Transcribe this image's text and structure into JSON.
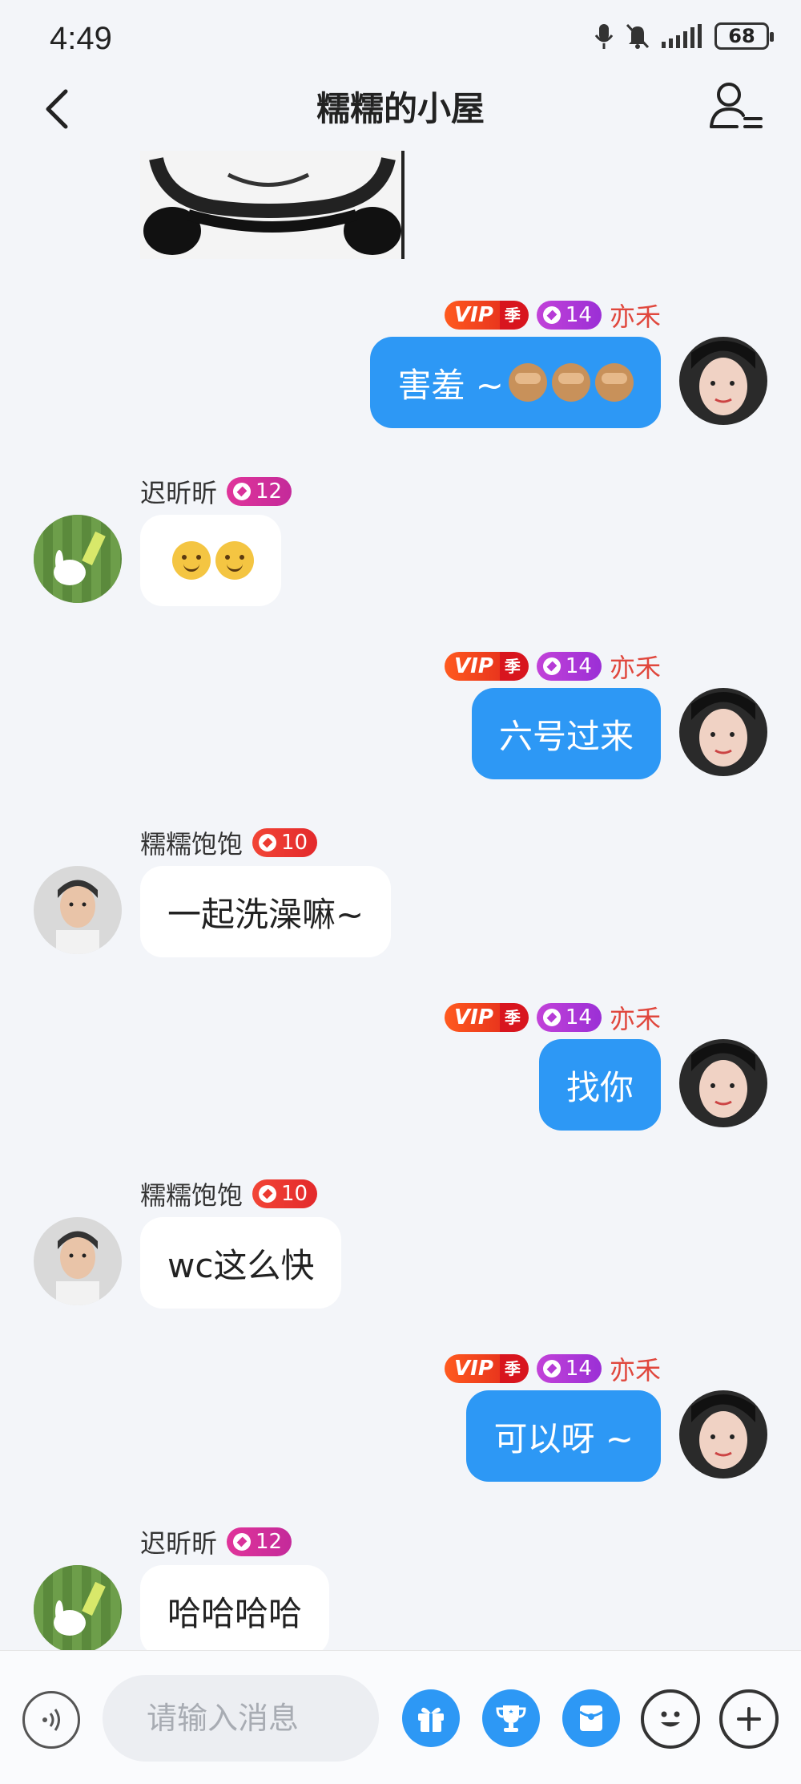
{
  "status_bar": {
    "time": "4:49",
    "battery": "68"
  },
  "header": {
    "title": "糯糯的小屋"
  },
  "messages": [
    {
      "dir": "out",
      "vip": "VIP",
      "vip_season": "季",
      "level": "14",
      "name": "亦禾",
      "text": "害羞 ~ ",
      "emojis": [
        "see-no-evil-monkey",
        "see-no-evil-monkey",
        "see-no-evil-monkey"
      ]
    },
    {
      "dir": "in",
      "name": "迟昕昕",
      "level": "12",
      "emojis": [
        "slightly-smiling-face",
        "slightly-smiling-face"
      ]
    },
    {
      "dir": "out",
      "vip": "VIP",
      "vip_season": "季",
      "level": "14",
      "name": "亦禾",
      "text": "六号过来"
    },
    {
      "dir": "in",
      "name": "糯糯饱饱",
      "level": "10",
      "text": "一起洗澡嘛~"
    },
    {
      "dir": "out",
      "vip": "VIP",
      "vip_season": "季",
      "level": "14",
      "name": "亦禾",
      "text": "找你"
    },
    {
      "dir": "in",
      "name": "糯糯饱饱",
      "level": "10",
      "text": "wc这么快"
    },
    {
      "dir": "out",
      "vip": "VIP",
      "vip_season": "季",
      "level": "14",
      "name": "亦禾",
      "text": "可以呀 ~"
    },
    {
      "dir": "in",
      "name": "迟昕昕",
      "level": "12",
      "text": "哈哈哈哈"
    }
  ],
  "input": {
    "placeholder": "请输入消息"
  },
  "colors": {
    "accent": "#2d98f5",
    "background": "#f3f5f9",
    "nick_out": "#e0473d"
  }
}
